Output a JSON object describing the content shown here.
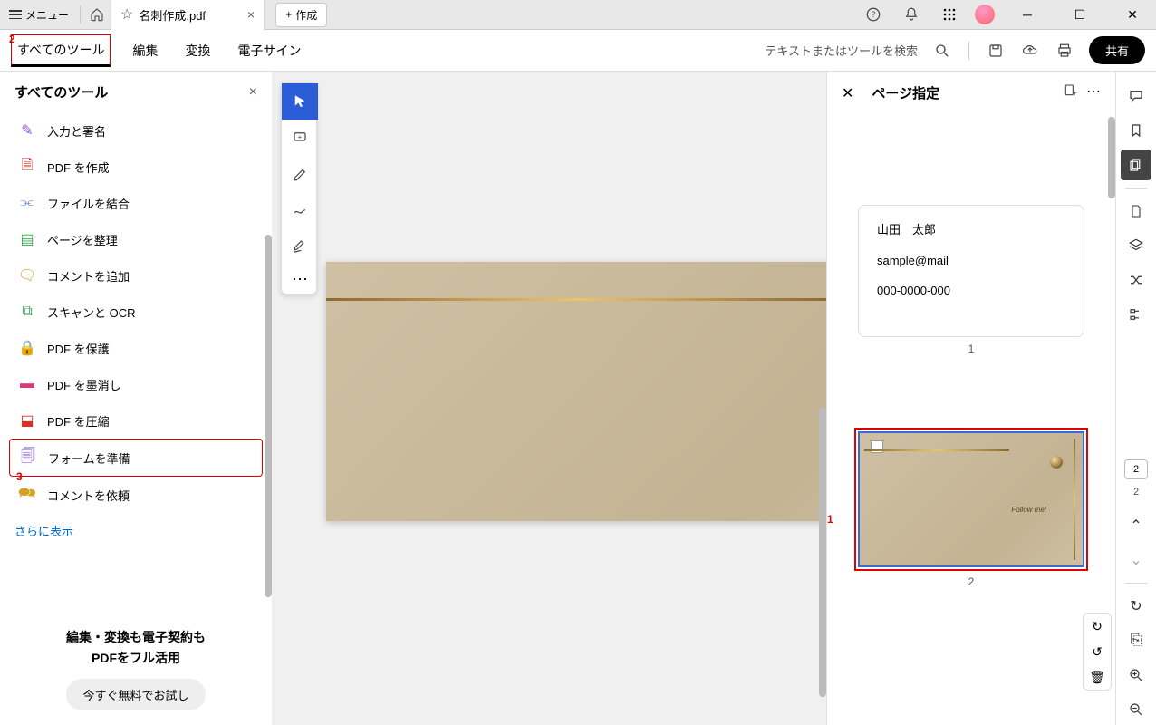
{
  "titlebar": {
    "menu": "メニュー",
    "tab_title": "名刺作成.pdf",
    "create": "作成"
  },
  "toolbar": {
    "all_tools": "すべてのツール",
    "edit": "編集",
    "convert": "変換",
    "esign": "電子サイン",
    "search_placeholder": "テキストまたはツールを検索",
    "share": "共有"
  },
  "left_panel": {
    "title": "すべてのツール",
    "items": [
      {
        "label": "入力と署名",
        "icon": "✎",
        "color": "#8a4fd6"
      },
      {
        "label": "PDF を作成",
        "icon": "🗎",
        "color": "#d93025"
      },
      {
        "label": "ファイルを結合",
        "icon": "⫘",
        "color": "#5a7dd6"
      },
      {
        "label": "ページを整理",
        "icon": "▤",
        "color": "#3aa655"
      },
      {
        "label": "コメントを追加",
        "icon": "🗨",
        "color": "#d8a020"
      },
      {
        "label": "スキャンと OCR",
        "icon": "⧉",
        "color": "#3aa655"
      },
      {
        "label": "PDF を保護",
        "icon": "🔒",
        "color": "#2a5dd6"
      },
      {
        "label": "PDF を墨消し",
        "icon": "▬",
        "color": "#d63a7a"
      },
      {
        "label": "PDF を圧縮",
        "icon": "⬓",
        "color": "#d93025"
      },
      {
        "label": "フォームを準備",
        "icon": "🗐",
        "color": "#8a4fd6"
      },
      {
        "label": "コメントを依頼",
        "icon": "🗪",
        "color": "#d8a020"
      }
    ],
    "more": "さらに表示",
    "promo_line1": "編集・変換も電子契約も",
    "promo_line2": "PDFをフル活用",
    "trial_btn": "今すぐ無料でお試し"
  },
  "canvas": {
    "follow_text": "Follow me!"
  },
  "right_panel": {
    "title": "ページ指定",
    "page1_num": "1",
    "page2_num": "2",
    "card": {
      "name": "山田　太郎",
      "email": "sample@mail",
      "phone": "000-0000-000"
    }
  },
  "rail": {
    "page_current": "2",
    "page_total": "2"
  },
  "annotations": {
    "a1": "1",
    "a2": "2",
    "a3": "3"
  }
}
